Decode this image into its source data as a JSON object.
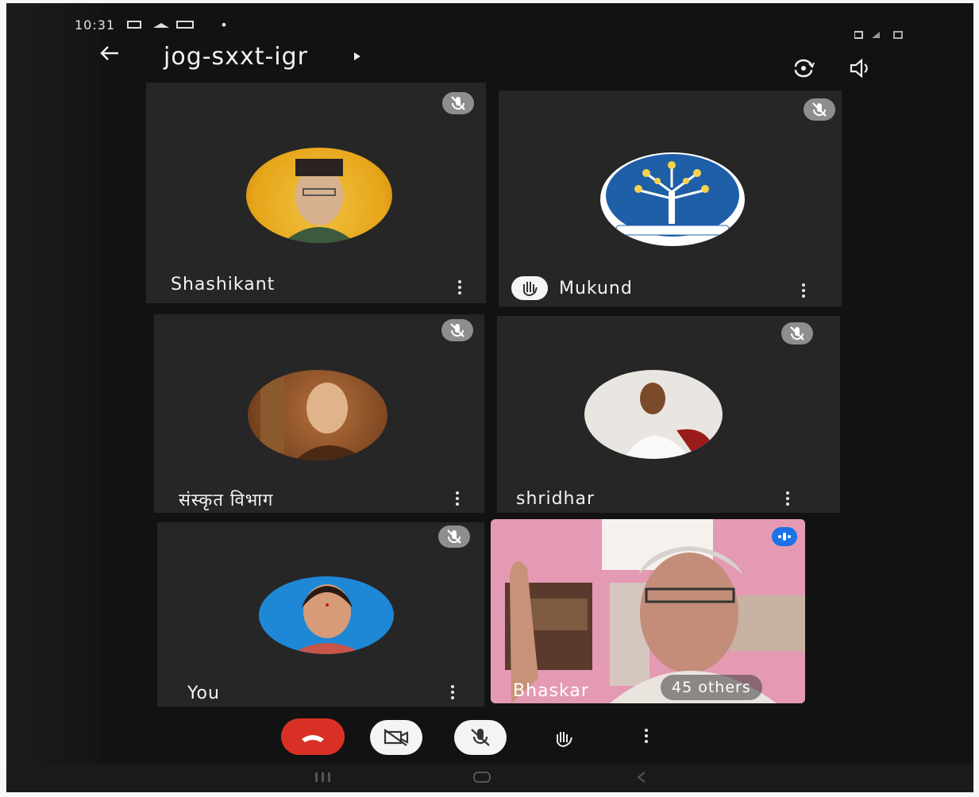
{
  "status_bar": {
    "time": "10:31",
    "dot": "•"
  },
  "meeting": {
    "code": "jog-sxxt-igr"
  },
  "participants": [
    {
      "name": "Shashikant",
      "hand_raised": false,
      "muted": true
    },
    {
      "name": "Mukund",
      "hand_raised": true,
      "muted": true
    },
    {
      "name": "संस्कृत विभाग",
      "hand_raised": false,
      "muted": true
    },
    {
      "name": "shridhar",
      "hand_raised": false,
      "muted": true
    },
    {
      "name": "You",
      "hand_raised": false,
      "muted": true
    },
    {
      "name": "Bhaskar",
      "hand_raised": false,
      "muted": false,
      "speaking": true
    }
  ],
  "others_label": "45 others",
  "icons": {
    "back": "back-arrow-icon",
    "switch_camera": "switch-camera-icon",
    "speaker": "speaker-icon",
    "mic_off": "mic-off-icon",
    "hand": "raised-hand-icon",
    "more": "more-vert-icon",
    "end_call": "end-call-icon",
    "camera_off": "camera-off-icon"
  },
  "colors": {
    "background": "#121212",
    "tile": "#262626",
    "end_call": "#d93025",
    "speaking_badge": "#1a73e8"
  }
}
